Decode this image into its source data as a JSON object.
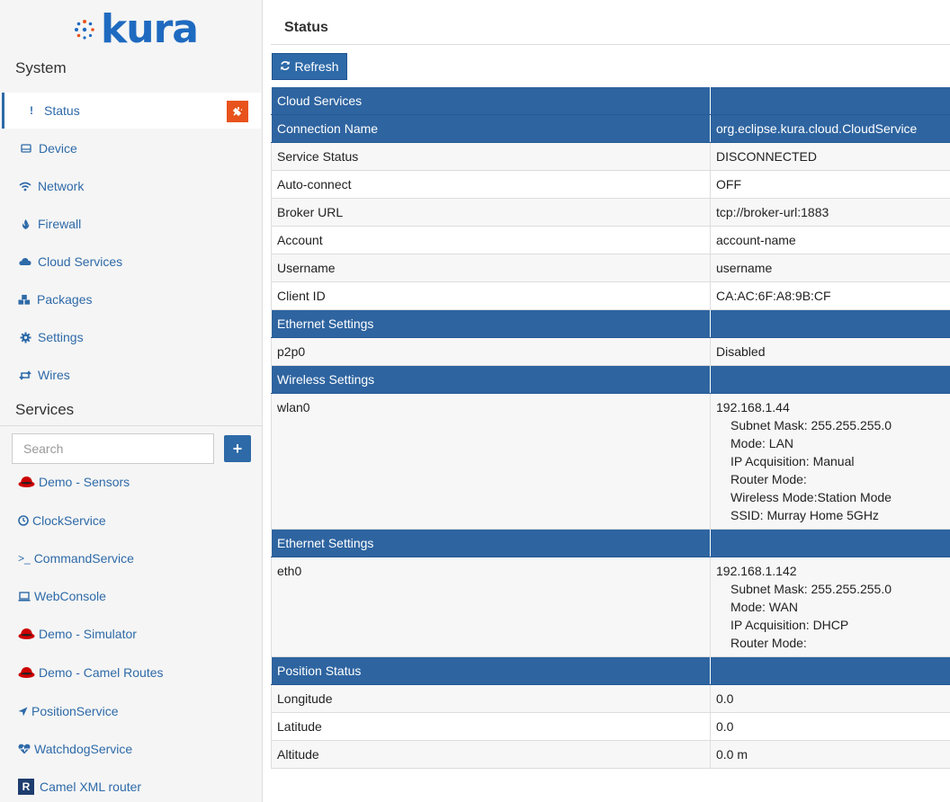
{
  "brand": "kura",
  "sidebar": {
    "system_title": "System",
    "system_items": [
      {
        "label": "Status",
        "icon": "exclamation-icon"
      },
      {
        "label": "Device",
        "icon": "drive-icon"
      },
      {
        "label": "Network",
        "icon": "wifi-icon"
      },
      {
        "label": "Firewall",
        "icon": "fire-icon"
      },
      {
        "label": "Cloud Services",
        "icon": "cloud-icon"
      },
      {
        "label": "Packages",
        "icon": "cubes-icon"
      },
      {
        "label": "Settings",
        "icon": "gear-icon"
      },
      {
        "label": "Wires",
        "icon": "retweet-icon"
      }
    ],
    "services_title": "Services",
    "search": {
      "placeholder": "Search",
      "value": ""
    },
    "add_label": "+",
    "services": [
      {
        "label": "Demo - Sensors",
        "icon": "redhat-icon"
      },
      {
        "label": "ClockService",
        "icon": "clock-icon"
      },
      {
        "label": "CommandService",
        "icon": "terminal-icon"
      },
      {
        "label": "WebConsole",
        "icon": "laptop-icon"
      },
      {
        "label": "Demo - Simulator",
        "icon": "redhat-icon"
      },
      {
        "label": "Demo - Camel Routes",
        "icon": "redhat-icon"
      },
      {
        "label": "PositionService",
        "icon": "location-arrow-icon"
      },
      {
        "label": "WatchdogService",
        "icon": "heartbeat-icon"
      },
      {
        "label": "Camel XML router",
        "icon": "r-badge-icon",
        "badge": "R"
      }
    ]
  },
  "main": {
    "title": "Status",
    "refresh_label": "Refresh",
    "sections": [
      {
        "header": "Cloud Services",
        "rows": [
          {
            "key": "Connection Name",
            "value": "org.eclipse.kura.cloud.CloudService",
            "highlight": true
          },
          {
            "key": "Service Status",
            "value": "DISCONNECTED"
          },
          {
            "key": "Auto-connect",
            "value": "OFF"
          },
          {
            "key": "Broker URL",
            "value": "tcp://broker-url:1883"
          },
          {
            "key": "Account",
            "value": "account-name"
          },
          {
            "key": "Username",
            "value": "username"
          },
          {
            "key": "Client ID",
            "value": "CA:AC:6F:A8:9B:CF"
          }
        ]
      },
      {
        "header": "Ethernet Settings",
        "rows": [
          {
            "key": "p2p0",
            "value": "Disabled"
          }
        ]
      },
      {
        "header": "Wireless Settings",
        "rows": [
          {
            "key": "wlan0",
            "value": "192.168.1.44",
            "details": [
              "Subnet Mask: 255.255.255.0",
              "Mode: LAN",
              "IP Acquisition: Manual",
              "Router Mode:",
              "Wireless Mode:Station Mode",
              "SSID: Murray Home 5GHz"
            ]
          }
        ]
      },
      {
        "header": "Ethernet Settings",
        "rows": [
          {
            "key": "eth0",
            "value": "192.168.1.142",
            "details": [
              "Subnet Mask: 255.255.255.0",
              "Mode: WAN",
              "IP Acquisition: DHCP",
              "Router Mode:"
            ]
          }
        ]
      },
      {
        "header": "Position Status",
        "rows": [
          {
            "key": "Longitude",
            "value": "0.0"
          },
          {
            "key": "Latitude",
            "value": "0.0"
          },
          {
            "key": "Altitude",
            "value": "0.0 m"
          }
        ]
      }
    ]
  },
  "colors": {
    "accent": "#2e64a0",
    "link": "#2e6aa8",
    "alert": "#e8531d",
    "sidebar_bg": "#f5f5f5"
  }
}
